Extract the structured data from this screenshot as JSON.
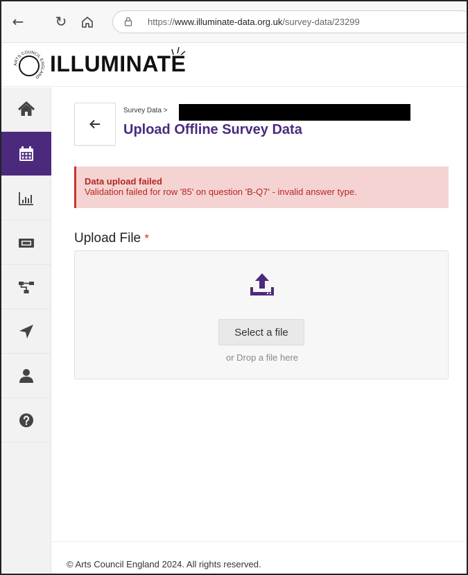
{
  "browser": {
    "url_prefix": "https://",
    "url_domain": "www.illuminate-data.org.uk",
    "url_path": "/survey-data/23299",
    "back_glyph": "←",
    "refresh_glyph": "↻"
  },
  "header": {
    "brand": "ILLUMINATE",
    "seal_text": "ARTS COUNCIL ENGLAND"
  },
  "sidebar": {
    "items": [
      {
        "icon": "home-icon",
        "active": false
      },
      {
        "icon": "calendar-icon",
        "active": true
      },
      {
        "icon": "bar-chart-icon",
        "active": false
      },
      {
        "icon": "ticket-icon",
        "active": false
      },
      {
        "icon": "hierarchy-icon",
        "active": false
      },
      {
        "icon": "paper-plane-icon",
        "active": false
      },
      {
        "icon": "user-icon",
        "active": false
      },
      {
        "icon": "help-icon",
        "active": false
      }
    ],
    "active_color": "#4b2a7e"
  },
  "main": {
    "breadcrumb": "Survey Data >",
    "title": "Upload Offline Survey Data",
    "alert": {
      "title": "Data upload failed",
      "message": "Validation failed for row '85' on question 'B-Q7' - invalid answer type."
    },
    "upload": {
      "label": "Upload File",
      "required_mark": "*",
      "button_label": "Select a file",
      "drop_hint": "or Drop a file here"
    }
  },
  "footer": {
    "text": "© Arts Council England 2024. All rights reserved."
  },
  "colors": {
    "brand_purple": "#4b2a7e",
    "error_red": "#b3261e",
    "alert_bg": "#f6d3d3"
  }
}
